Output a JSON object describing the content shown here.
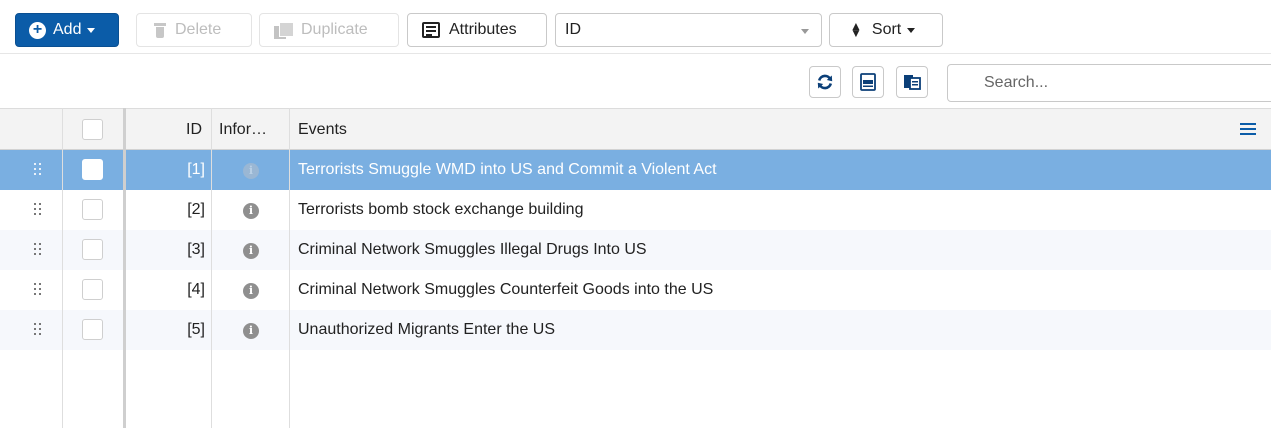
{
  "toolbar": {
    "add_label": "Add",
    "delete_label": "Delete",
    "duplicate_label": "Duplicate",
    "attributes_label": "Attributes",
    "column_select_value": "ID",
    "sort_label": "Sort"
  },
  "search": {
    "placeholder": "Search..."
  },
  "grid": {
    "columns": [
      "ID",
      "Infor…",
      "Events"
    ],
    "rows": [
      {
        "id": "[1]",
        "event": "Terrorists Smuggle WMD into US and Commit a Violent Act",
        "selected": true
      },
      {
        "id": "[2]",
        "event": "Terrorists bomb stock exchange building",
        "selected": false
      },
      {
        "id": "[3]",
        "event": "Criminal Network Smuggles Illegal Drugs Into US",
        "selected": false
      },
      {
        "id": "[4]",
        "event": "Criminal Network Smuggles Counterfeit Goods into the US",
        "selected": false
      },
      {
        "id": "[5]",
        "event": "Unauthorized Migrants Enter the US",
        "selected": false
      }
    ],
    "info_glyph": "i"
  },
  "colors": {
    "primary": "#0b5ca8",
    "selected_row": "#7aafe1",
    "header_bg": "#f3f3f3"
  },
  "icons": [
    "plus-circle-icon",
    "trash-icon",
    "duplicate-icon",
    "list-icon",
    "sort-icon",
    "refresh-icon",
    "export-xlsx-icon",
    "copy-icon",
    "info-icon",
    "drag-handle-icon",
    "column-menu-icon"
  ]
}
